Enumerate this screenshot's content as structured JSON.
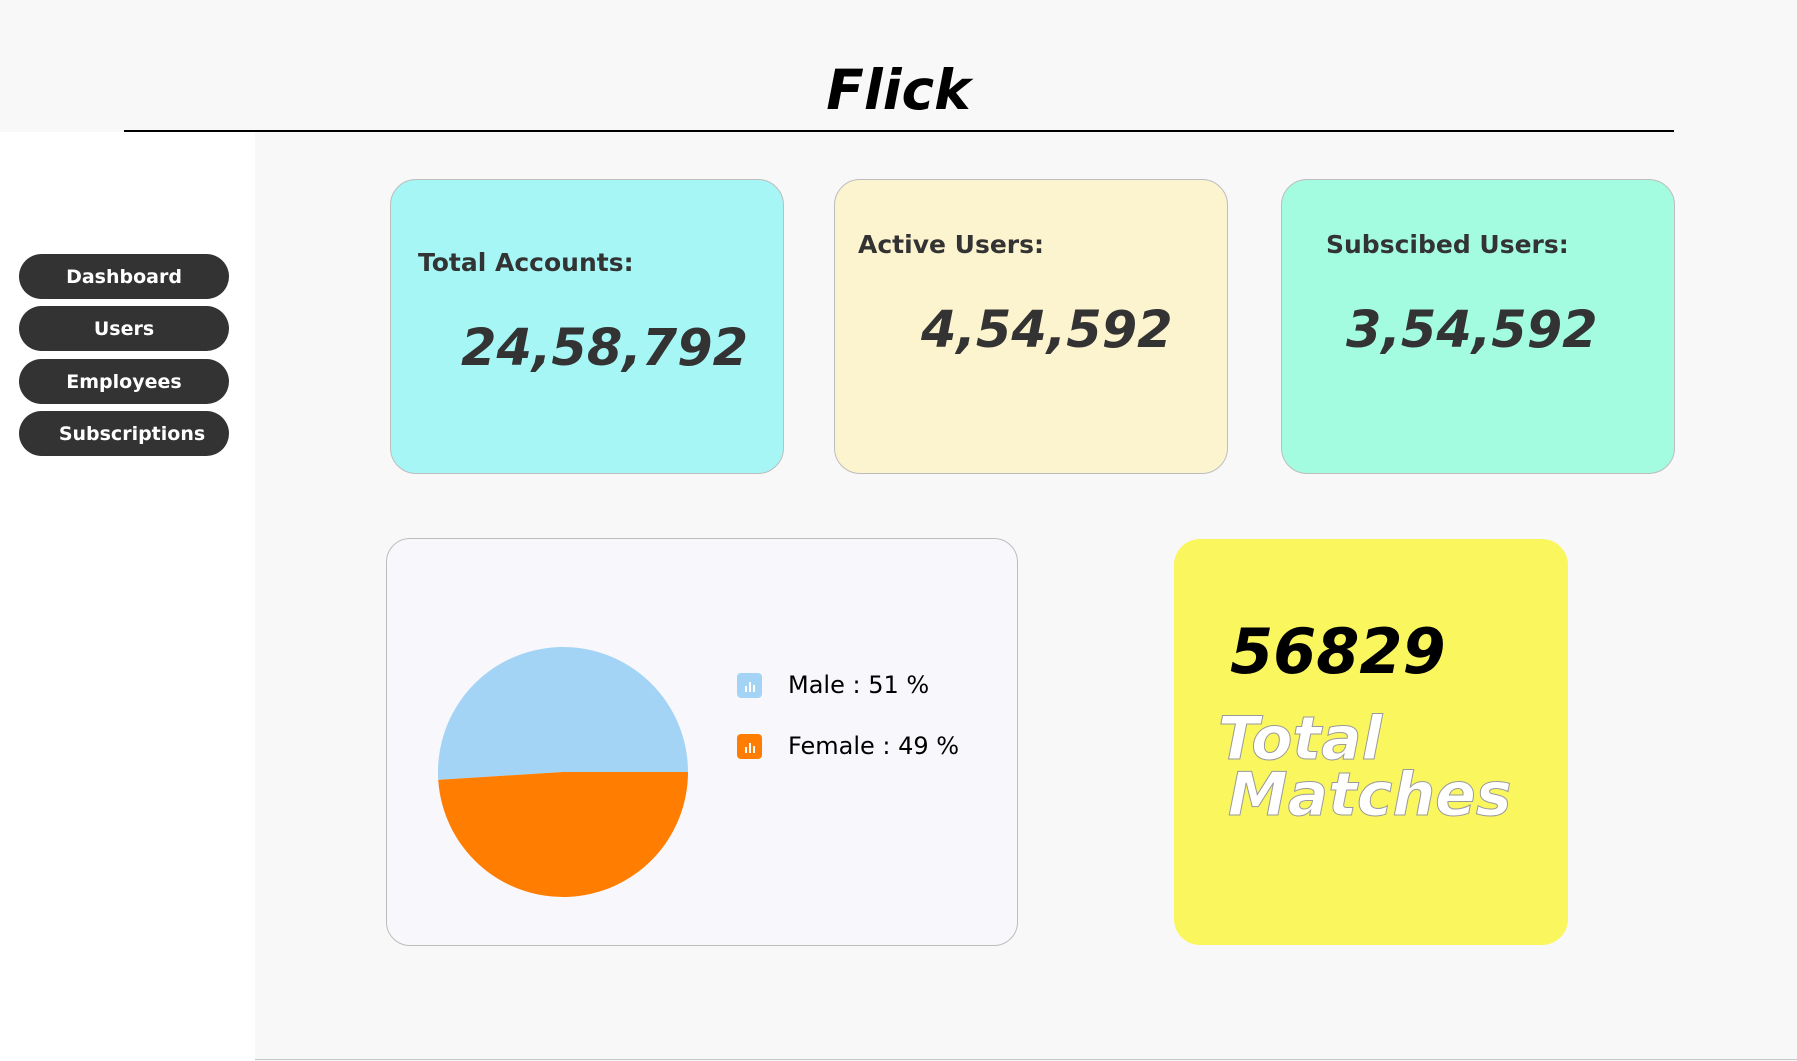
{
  "app": {
    "title": "Flick"
  },
  "sidebar": {
    "items": [
      {
        "label": "Dashboard"
      },
      {
        "label": "Users"
      },
      {
        "label": "Employees"
      },
      {
        "label": "Subscriptions"
      }
    ]
  },
  "stats": [
    {
      "label": "Total Accounts:",
      "value": "24,58,792",
      "color": "#a6f6f6"
    },
    {
      "label": "Active Users:",
      "value": "4,54,592",
      "color": "#fcf3cf"
    },
    {
      "label": "Subscibed Users:",
      "value": "3,54,592",
      "color": "#a3fbe0"
    }
  ],
  "gender_chart": {
    "legend": [
      {
        "label": "Male : 51 %",
        "color": "#a4d4f5",
        "icon": "bar-chart-icon"
      },
      {
        "label": "Female : 49 %",
        "color": "#ff7d00",
        "icon": "bar-chart-icon"
      }
    ]
  },
  "chart_data": {
    "type": "pie",
    "slices": [
      {
        "label": "Male",
        "value": 51,
        "color": "#a4d4f5"
      },
      {
        "label": "Female",
        "value": 49,
        "color": "#ff7d00"
      }
    ]
  },
  "matches": {
    "value": "56829",
    "label_line1": "Total",
    "label_line2": "Matches",
    "color": "#faf65e"
  }
}
